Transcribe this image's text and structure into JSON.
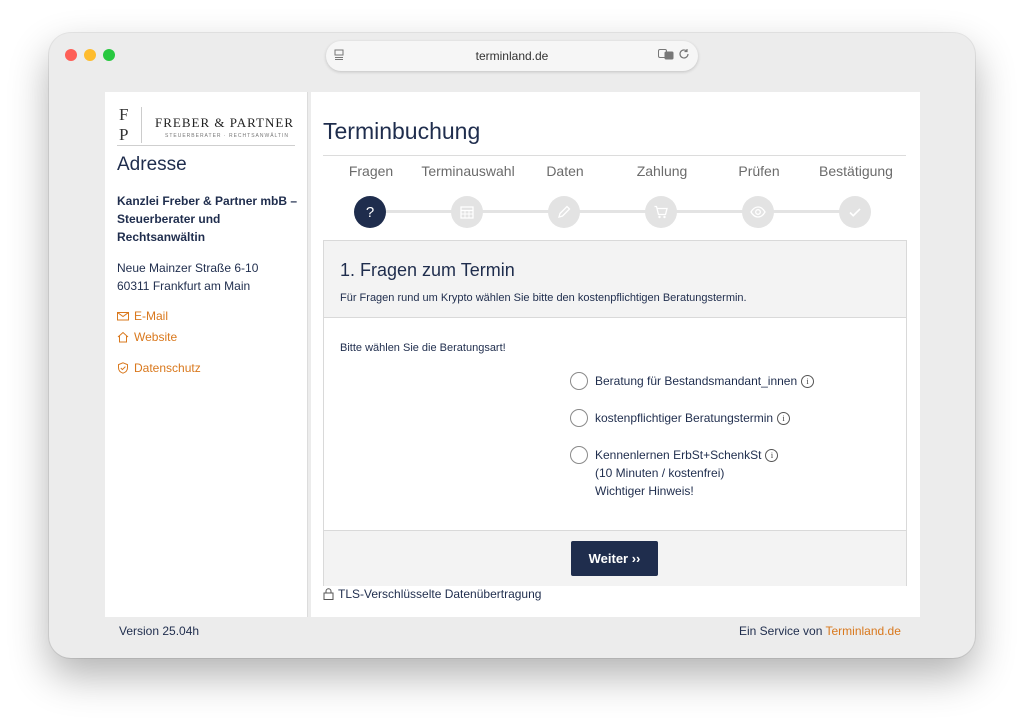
{
  "browser": {
    "url": "terminland.de"
  },
  "sidebar": {
    "logo": {
      "monogram_top": "F",
      "monogram_bottom": "P",
      "name": "FREBER & PARTNER",
      "tagline": "STEUERBERATER · RECHTSANWÄLTIN"
    },
    "heading": "Adresse",
    "firm_name": "Kanzlei Freber & Partner mbB – Steuerberater und Rechtsanwältin",
    "street": "Neue Mainzer Straße 6-10",
    "city": "60311 Frankfurt am Main",
    "links": {
      "email": "E-Mail",
      "website": "Website",
      "privacy": "Datenschutz"
    }
  },
  "main": {
    "title": "Terminbuchung",
    "steps": [
      {
        "label": "Fragen",
        "icon": "question-icon",
        "active": true,
        "symbol": "?"
      },
      {
        "label": "Terminauswahl",
        "icon": "calendar-icon",
        "active": false
      },
      {
        "label": "Daten",
        "icon": "pencil-icon",
        "active": false
      },
      {
        "label": "Zahlung",
        "icon": "cart-icon",
        "active": false
      },
      {
        "label": "Prüfen",
        "icon": "eye-icon",
        "active": false
      },
      {
        "label": "Bestätigung",
        "icon": "check-icon",
        "active": false
      }
    ],
    "card": {
      "title": "1. Fragen zum Termin",
      "subtitle": "Für Fragen rund um Krypto wählen Sie bitte den kostenpflichtigen Beratungstermin.",
      "prompt": "Bitte wählen Sie die Beratungsart!",
      "options": [
        {
          "label": "Beratung für Bestandsmandant_innen"
        },
        {
          "label": "kostenpflichtiger Beratungstermin"
        },
        {
          "label": "Kennenlernen ErbSt+SchenkSt",
          "line2": "(10 Minuten / kostenfrei)",
          "line3": "Wichtiger Hinweis!"
        }
      ],
      "next_button": "Weiter ››"
    },
    "tls_note": "TLS-Verschlüsselte Datenübertragung"
  },
  "footer": {
    "version": "Version 25.04h",
    "service_prefix": "Ein Service von ",
    "service_brand": "Terminland.de"
  },
  "colors": {
    "navy": "#1f2d4d",
    "accent_orange": "#d9781d",
    "step_inactive": "#e3e3e3"
  }
}
